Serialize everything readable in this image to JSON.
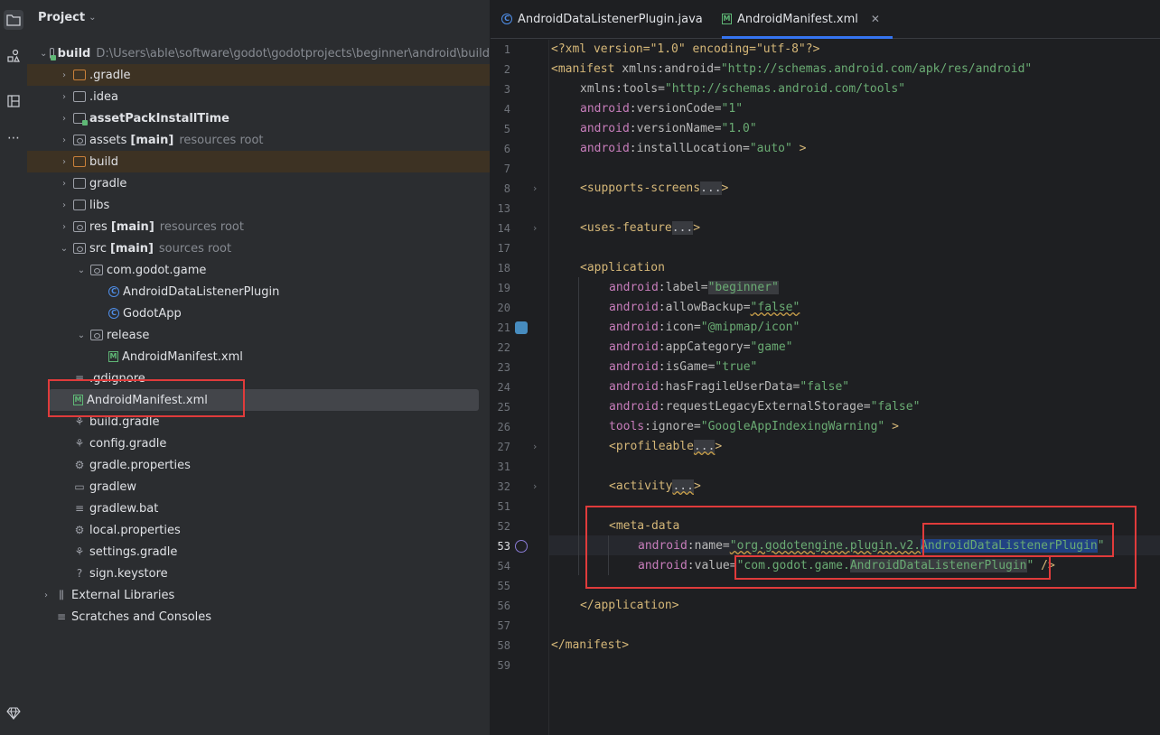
{
  "activity_bar": {
    "icons": [
      "folder-icon",
      "structure-icon",
      "layout-icon",
      "more-icon",
      "diamond-icon"
    ]
  },
  "project": {
    "title": "Project",
    "tree": [
      {
        "label": "build",
        "path": "D:\\Users\\able\\software\\godot\\godotprojects\\beginner\\android\\build"
      },
      {
        "label": ".gradle"
      },
      {
        "label": ".idea"
      },
      {
        "label": "assetPackInstallTime"
      },
      {
        "label": "assets",
        "badge": "[main]",
        "note": "resources root"
      },
      {
        "label": "build"
      },
      {
        "label": "gradle"
      },
      {
        "label": "libs"
      },
      {
        "label": "res",
        "badge": "[main]",
        "note": "resources root"
      },
      {
        "label": "src",
        "badge": "[main]",
        "note": "sources root"
      },
      {
        "label": "com.godot.game"
      },
      {
        "label": "AndroidDataListenerPlugin"
      },
      {
        "label": "GodotApp"
      },
      {
        "label": "release"
      },
      {
        "label": "AndroidManifest.xml"
      },
      {
        "label": ".gdignore"
      },
      {
        "label": "AndroidManifest.xml"
      },
      {
        "label": "build.gradle"
      },
      {
        "label": "config.gradle"
      },
      {
        "label": "gradle.properties"
      },
      {
        "label": "gradlew"
      },
      {
        "label": "gradlew.bat"
      },
      {
        "label": "local.properties"
      },
      {
        "label": "settings.gradle"
      },
      {
        "label": "sign.keystore"
      },
      {
        "label": "External Libraries"
      },
      {
        "label": "Scratches and Consoles"
      }
    ]
  },
  "editor": {
    "tabs": [
      {
        "label": "AndroidDataListenerPlugin.java",
        "active": false
      },
      {
        "label": "AndroidManifest.xml",
        "active": true
      }
    ],
    "line_numbers": [
      "1",
      "2",
      "3",
      "4",
      "5",
      "6",
      "7",
      "8",
      "13",
      "14",
      "17",
      "18",
      "19",
      "20",
      "21",
      "22",
      "23",
      "24",
      "25",
      "26",
      "27",
      "31",
      "32",
      "51",
      "52",
      "53",
      "54",
      "55",
      "56",
      "57",
      "58",
      "59"
    ],
    "current_line": "53",
    "code": {
      "l1": "<?xml version=\"1.0\" encoding=\"utf-8\"?>",
      "manifest_open": "<manifest",
      "xmlns_attr": " xmlns:android=",
      "xmlns_val": "\"http://schemas.android.com/apk/res/android\"",
      "tools_attr": "xmlns:tools=",
      "tools_val": "\"http://schemas.android.com/tools\"",
      "versionCode": ":versionCode=",
      "versionCode_val": "\"1\"",
      "versionName": ":versionName=",
      "versionName_val": "\"1.0\"",
      "installLocation": ":installLocation=",
      "installLocation_val": "\"auto\"",
      "gt": " >",
      "android": "android",
      "tools": "tools",
      "supports_screens": "<supports-screens",
      "uses_feature": "<uses-feature",
      "ellipsis": "...",
      "close": ">",
      "application": "<application",
      "label": ":label=",
      "label_val": "\"beginner\"",
      "allowBackup": ":allowBackup=",
      "allowBackup_val": "\"false\"",
      "icon": ":icon=",
      "icon_val": "\"@mipmap/icon\"",
      "appCategory": ":appCategory=",
      "appCategory_val": "\"game\"",
      "isGame": ":isGame=",
      "isGame_val": "\"true\"",
      "hasFragile": ":hasFragileUserData=",
      "hasFragile_val": "\"false\"",
      "legacy": ":requestLegacyExternalStorage=",
      "legacy_val": "\"false\"",
      "ignore": ":ignore=",
      "ignore_val": "\"GoogleAppIndexingWarning\"",
      "profileable": "<profileable",
      "activity": "<activity",
      "meta_data": "<meta-data",
      "name_attr": ":name=",
      "name_val_prefix": "\"org.godotengine.plugin.v2.",
      "name_val_hl": "AndroidDataListenerPlugin",
      "quote": "\"",
      "value_attr": ":value=",
      "value_val_prefix": "\"com.godot.game.",
      "value_val_hl": "AndroidDataListenerPlugin",
      "selfclose": " />",
      "application_close": "</application>",
      "manifest_close": "</manifest>"
    }
  }
}
